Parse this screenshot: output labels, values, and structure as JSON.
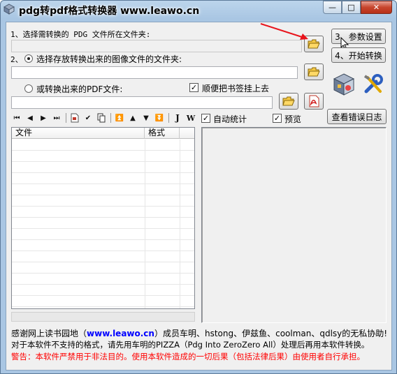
{
  "window": {
    "title": "pdg转pdf格式转换器 www.leawo.cn",
    "min_glyph": "—",
    "max_glyph": "□",
    "close_glyph": "✕"
  },
  "step1": {
    "label": "1、选择需转换的 PDG 文件所在文件夹:",
    "path_value": ""
  },
  "step2": {
    "label": "2、",
    "radio_image_label": "选择存放转换出来的图像文件的文件夹:",
    "image_path_value": "",
    "radio_pdf_label": "或转换出来的PDF文件:",
    "pdf_path_value": "",
    "bookmark_check_label": "顺便把书签挂上去",
    "bookmark_checked": true
  },
  "buttons": {
    "settings": "3、参数设置",
    "start": "4、开始转换",
    "view_errors": "查看错误日志"
  },
  "options": {
    "auto_stats_label": "自动统计",
    "auto_stats_checked": true,
    "preview_label": "预览",
    "preview_checked": true
  },
  "toolbar": {
    "glyphs": [
      "⏮",
      "◀",
      "▶",
      "⏭",
      "",
      "✔",
      "",
      "⏫",
      "▲",
      "▼",
      "⏬",
      "J",
      "W"
    ]
  },
  "file_list": {
    "columns": [
      "文件",
      "格式"
    ],
    "rows": []
  },
  "footer": {
    "thanks_prefix": "感谢网上读书园地（",
    "thanks_link": "www.leawo.cn",
    "thanks_suffix": "）成员车明、hstong、伊兹鱼、coolman、qdlsy的无私协助!",
    "note": "对于本软件不支持的格式，请先用车明的PIZZA（Pdg Into ZeroZero All）处理后再用本软件转换。",
    "warning": "警告：本软件严禁用于非法目的。使用本软件造成的一切后果（包括法律后果）由使用者自行承担。"
  },
  "colors": {
    "link": "#0000ff",
    "warning": "#ff0000",
    "arrow": "#e8141c"
  }
}
